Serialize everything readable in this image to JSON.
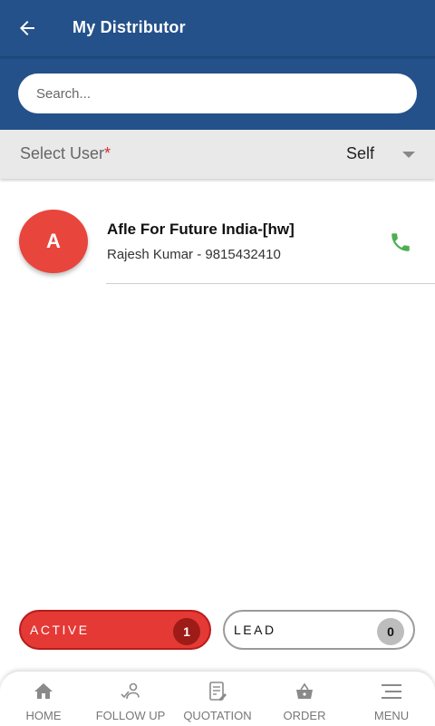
{
  "header": {
    "title": "My Distributor"
  },
  "search": {
    "placeholder": "Search..."
  },
  "select_user": {
    "label": "Select User",
    "required_mark": "*",
    "value": "Self"
  },
  "distributors": [
    {
      "initial": "A",
      "name": "Afle For Future India-[hw]",
      "contact": "Rajesh Kumar - 9815432410"
    }
  ],
  "filters": {
    "active": {
      "label": "ACTIVE",
      "count": "1"
    },
    "lead": {
      "label": "LEAD",
      "count": "0"
    }
  },
  "bottom_nav": [
    {
      "label": "HOME",
      "icon": "home-icon"
    },
    {
      "label": "FOLLOW UP",
      "icon": "follow-up-icon"
    },
    {
      "label": "QUOTATION",
      "icon": "quotation-icon"
    },
    {
      "label": "ORDER",
      "icon": "basket-icon"
    },
    {
      "label": "MENU",
      "icon": "menu-icon"
    }
  ],
  "colors": {
    "header": "#24518a",
    "accent_red": "#e53935",
    "avatar": "#e8453c",
    "phone": "#4caf50"
  }
}
